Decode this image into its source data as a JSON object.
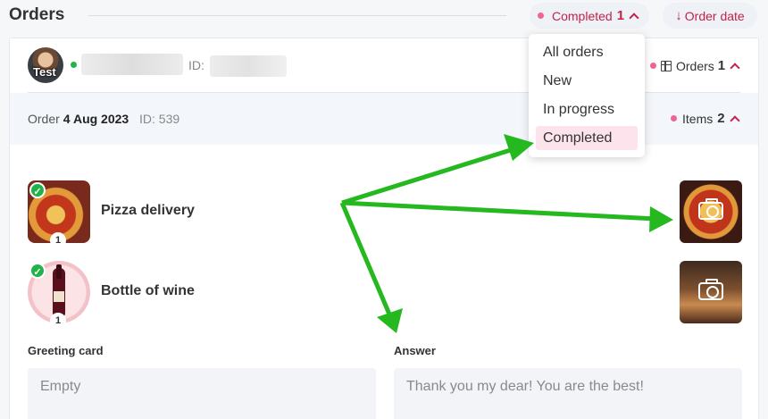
{
  "header": {
    "title": "Orders",
    "filter": {
      "label": "Completed",
      "count": "1"
    },
    "sort": {
      "label": "Order date",
      "arrow": "↓"
    }
  },
  "user": {
    "avatar_text": "Test",
    "id_label": "ID:",
    "orders_label": "Orders",
    "orders_count": "1"
  },
  "order": {
    "label": "Order",
    "date": "4 Aug 2023",
    "id_text": "ID: 539",
    "items_label": "Items",
    "items_count": "2"
  },
  "items": [
    {
      "name": "Pizza delivery",
      "qty": "1",
      "check": "✓"
    },
    {
      "name": "Bottle of wine",
      "qty": "1",
      "check": "✓"
    }
  ],
  "greeting": {
    "label": "Greeting card",
    "value": "Empty"
  },
  "answer": {
    "label": "Answer",
    "value": "Thank you my dear! You are the best!"
  },
  "dropdown": {
    "options": [
      "All orders",
      "New",
      "In progress",
      "Completed"
    ],
    "selected": "Completed"
  },
  "colors": {
    "accent": "#c3224b",
    "dot": "#f06493",
    "check": "#22b24c",
    "arrow": "#25b81f"
  }
}
